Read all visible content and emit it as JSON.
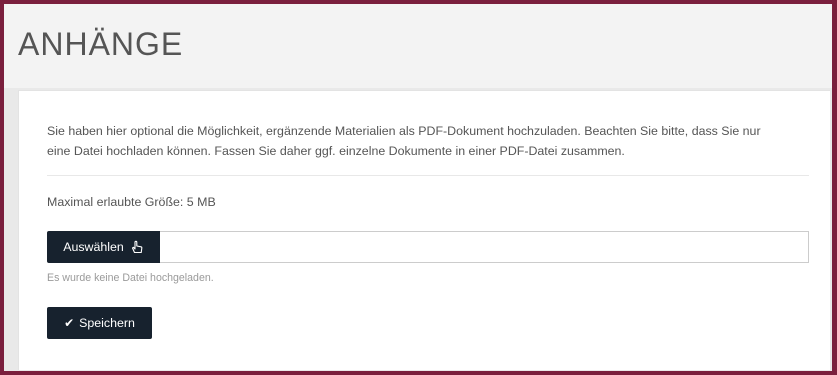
{
  "section": {
    "title": "ANHÄNGE"
  },
  "upload": {
    "intro_line1": "Sie haben hier optional die Möglichkeit, ergänzende Materialien als PDF-Dokument hochzuladen. Beachten Sie bitte, dass Sie nur",
    "intro_line2": "eine Datei hochladen können. Fassen Sie daher ggf. einzelne Dokumente in einer PDF-Datei zusammen.",
    "max_size": "Maximal erlaubte Größe: 5 MB",
    "choose_label": "Auswählen",
    "choose_icon": "hand-pointer-icon",
    "file_value": "",
    "status_text": "Es wurde keine Datei hochgeladen.",
    "save_label": "Speichern",
    "save_icon": "check-icon"
  },
  "colors": {
    "frame": "#7a1f3d",
    "button_bg": "#17222e",
    "text": "#555555"
  }
}
